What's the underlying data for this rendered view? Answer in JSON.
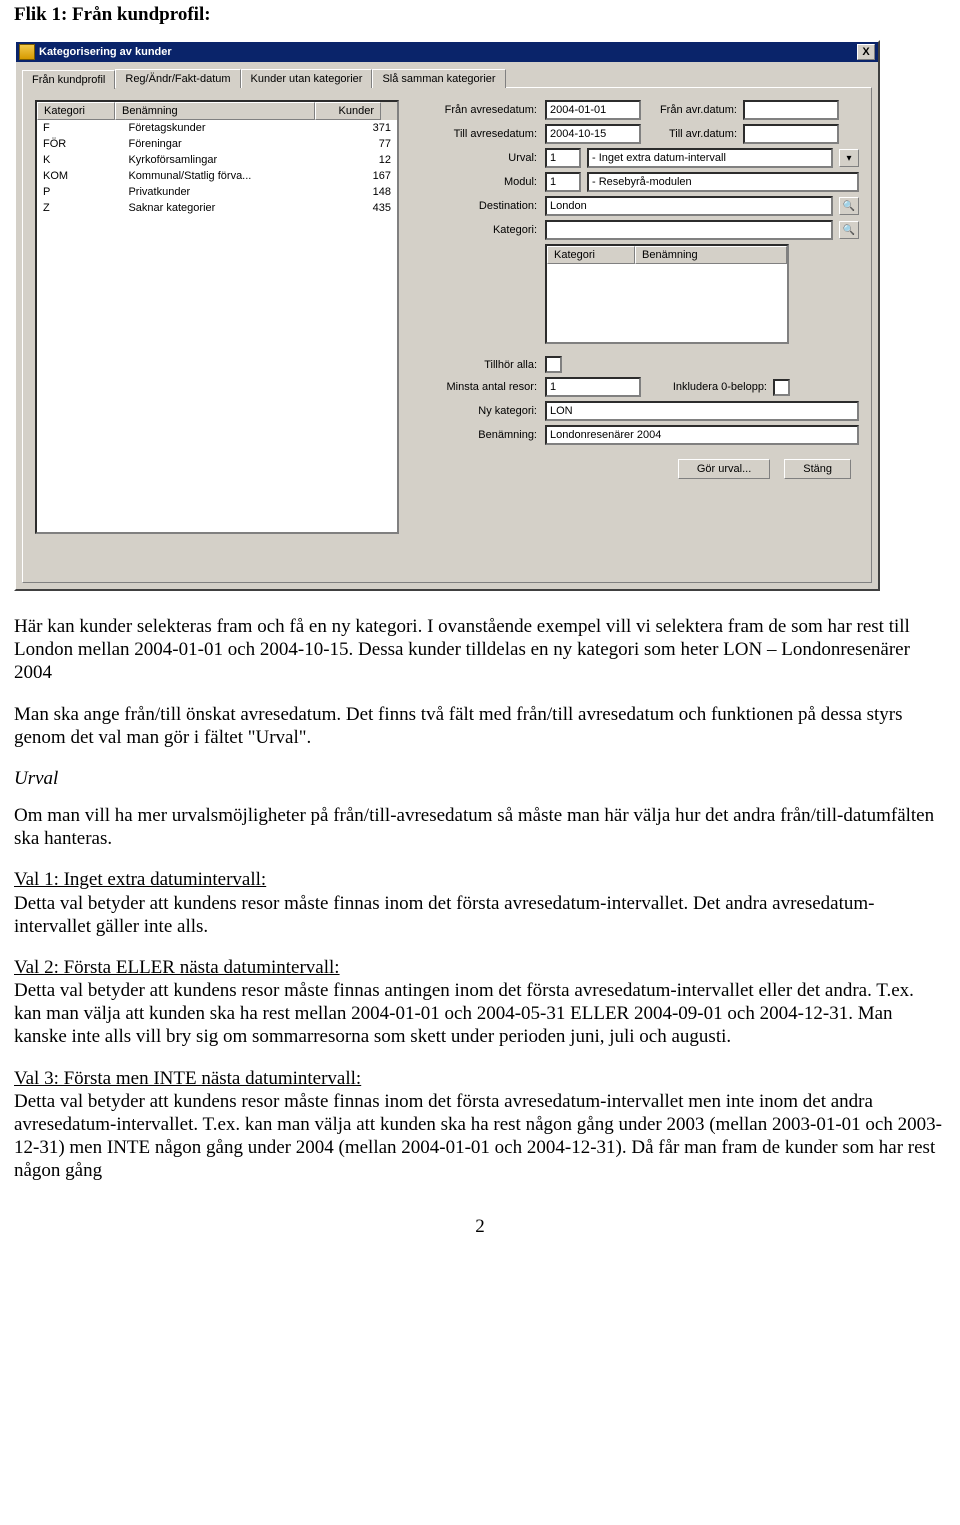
{
  "heading": "Flik 1: Från kundprofil:",
  "window": {
    "title": "Kategorisering av kunder",
    "close": "X",
    "tabs": [
      "Från kundprofil",
      "Reg/Ändr/Fakt-datum",
      "Kunder utan kategorier",
      "Slå samman kategorier"
    ],
    "left_table": {
      "headers": [
        "Kategori",
        "Benämning",
        "Kunder"
      ],
      "rows": [
        {
          "a": "F",
          "b": "Företagskunder",
          "c": "371"
        },
        {
          "a": "FÖR",
          "b": "Föreningar",
          "c": "77"
        },
        {
          "a": "K",
          "b": "Kyrkoförsamlingar",
          "c": "12"
        },
        {
          "a": "KOM",
          "b": "Kommunal/Statlig förva...",
          "c": "167"
        },
        {
          "a": "P",
          "b": "Privatkunder",
          "c": "148"
        },
        {
          "a": "Z",
          "b": "Saknar kategorier",
          "c": "435"
        }
      ]
    },
    "form": {
      "fran_avresedatum_lbl": "Från avresedatum:",
      "fran_avresedatum_val": "2004-01-01",
      "fran_avr_datum_lbl": "Från avr.datum:",
      "fran_avr_datum_val": "",
      "till_avresedatum_lbl": "Till avresedatum:",
      "till_avresedatum_val": "2004-10-15",
      "till_avr_datum_lbl": "Till avr.datum:",
      "till_avr_datum_val": "",
      "urval_lbl": "Urval:",
      "urval_num": "1",
      "urval_txt": "- Inget extra datum-intervall",
      "modul_lbl": "Modul:",
      "modul_num": "1",
      "modul_txt": "- Resebyrå-modulen",
      "destination_lbl": "Destination:",
      "destination_val": "London",
      "kategori_lbl": "Kategori:",
      "kategori_val": "",
      "mini_headers": [
        "Kategori",
        "Benämning"
      ],
      "tillhor_alla_lbl": "Tillhör alla:",
      "minsta_antal_lbl": "Minsta antal resor:",
      "minsta_antal_val": "1",
      "inkludera_0_lbl": "Inkludera 0-belopp:",
      "ny_kategori_lbl": "Ny kategori:",
      "ny_kategori_val": "LON",
      "benamning_lbl": "Benämning:",
      "benamning_val": "Londonresenärer 2004",
      "btn_gor_urval": "Gör urval...",
      "btn_stang": "Stäng"
    }
  },
  "doc": {
    "p1": "Här kan kunder selekteras fram och få en ny kategori. I ovanstående exempel vill vi selektera fram de som har rest till London mellan 2004-01-01 och 2004-10-15. Dessa kunder tilldelas en ny kategori som heter LON – Londonresenärer 2004",
    "p2": "Man ska ange från/till önskat avresedatum. Det finns två fält med från/till avresedatum och funktionen på dessa styrs genom det val man gör i fältet \"Urval\".",
    "urval_h": "Urval",
    "p3": "Om man vill ha mer urvalsmöjligheter på från/till-avresedatum så måste man här välja hur det andra från/till-datumfälten ska hanteras.",
    "v1_h": "Val 1: Inget extra datumintervall:",
    "v1_t": "Detta val betyder att kundens resor måste finnas inom det första avresedatum-intervallet. Det andra avresedatum-intervallet gäller inte alls.",
    "v2_h": "Val 2: Första ELLER nästa datumintervall:",
    "v2_t": "Detta val betyder att kundens resor måste finnas antingen inom det första avresedatum-intervallet eller det andra. T.ex. kan man välja att kunden ska ha rest mellan 2004-01-01 och 2004-05-31 ELLER 2004-09-01 och 2004-12-31. Man kanske inte alls vill bry sig om sommarresorna som skett under perioden juni, juli och augusti.",
    "v3_h": "Val 3: Första men INTE nästa datumintervall:",
    "v3_t": "Detta val betyder att kundens resor måste finnas inom det första avresedatum-intervallet men inte inom det andra avresedatum-intervallet. T.ex. kan man välja att kunden ska ha rest någon gång under 2003 (mellan 2003-01-01 och 2003-12-31) men INTE någon gång under 2004 (mellan 2004-01-01 och 2004-12-31). Då får man fram de kunder som har rest någon gång"
  },
  "page_number": "2"
}
